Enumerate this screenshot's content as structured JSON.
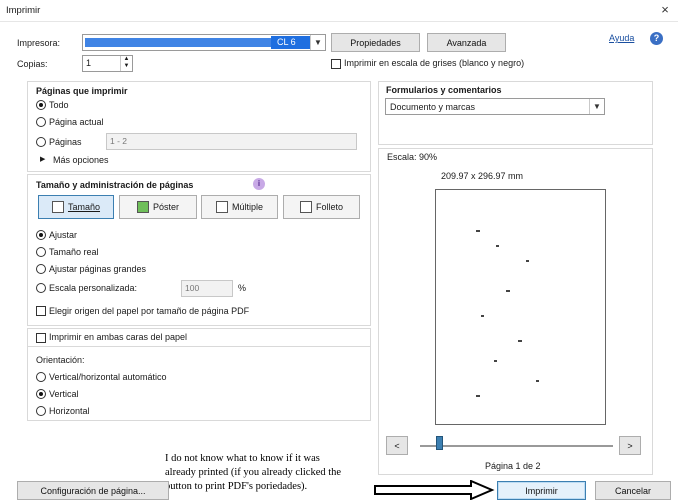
{
  "window": {
    "title": "Imprimir",
    "close_glyph": "×"
  },
  "printer": {
    "label": "Impresora:",
    "value_suffix": "CL 6",
    "properties_button": "Propiedades",
    "advanced_button": "Avanzada",
    "help_link": "Ayuda",
    "help_glyph": "?"
  },
  "copies": {
    "label": "Copias:",
    "value": "1",
    "grayscale_label": "Imprimir en escala de grises (blanco y negro)"
  },
  "pages": {
    "title": "Páginas que imprimir",
    "all": "Todo",
    "current": "Página actual",
    "pages": "Páginas",
    "pages_placeholder": "1 - 2",
    "more_options": "Más opciones"
  },
  "sizing": {
    "title": "Tamaño y administración de páginas",
    "info_glyph": "i",
    "tabs": [
      "Tamaño",
      "Póster",
      "Múltiple",
      "Folleto"
    ],
    "fit": "Ajustar",
    "actual": "Tamaño real",
    "shrink": "Ajustar páginas grandes",
    "custom": "Escala personalizada:",
    "custom_value": "100",
    "percent": "%",
    "paper_source": "Elegir origen del papel por tamaño de página PDF"
  },
  "duplex": {
    "label": "Imprimir en ambas caras del papel"
  },
  "orientation": {
    "title": "Orientación:",
    "auto": "Vertical/horizontal automático",
    "portrait": "Vertical",
    "landscape": "Horizontal"
  },
  "forms": {
    "title": "Formularios y comentarios",
    "value": "Documento y marcas"
  },
  "preview": {
    "scale": "Escala:  90%",
    "dimensions": "209.97 x 296.97 mm",
    "prev": "<",
    "next": ">",
    "page_indicator": "Página 1 de 2",
    "slider_fraction": 0.02
  },
  "annotation": {
    "lines": [
      "I do not know what to know if it was",
      "already printed (if you already clicked the",
      "button to print PDF's poriedades)."
    ]
  },
  "footer": {
    "page_setup": "Configuración de página...",
    "print": "Imprimir",
    "cancel": "Cancelar"
  },
  "colors": {
    "accent": "#3c7fb1",
    "help_link": "#1a4fa0",
    "redaction": "#1f6fe0"
  }
}
